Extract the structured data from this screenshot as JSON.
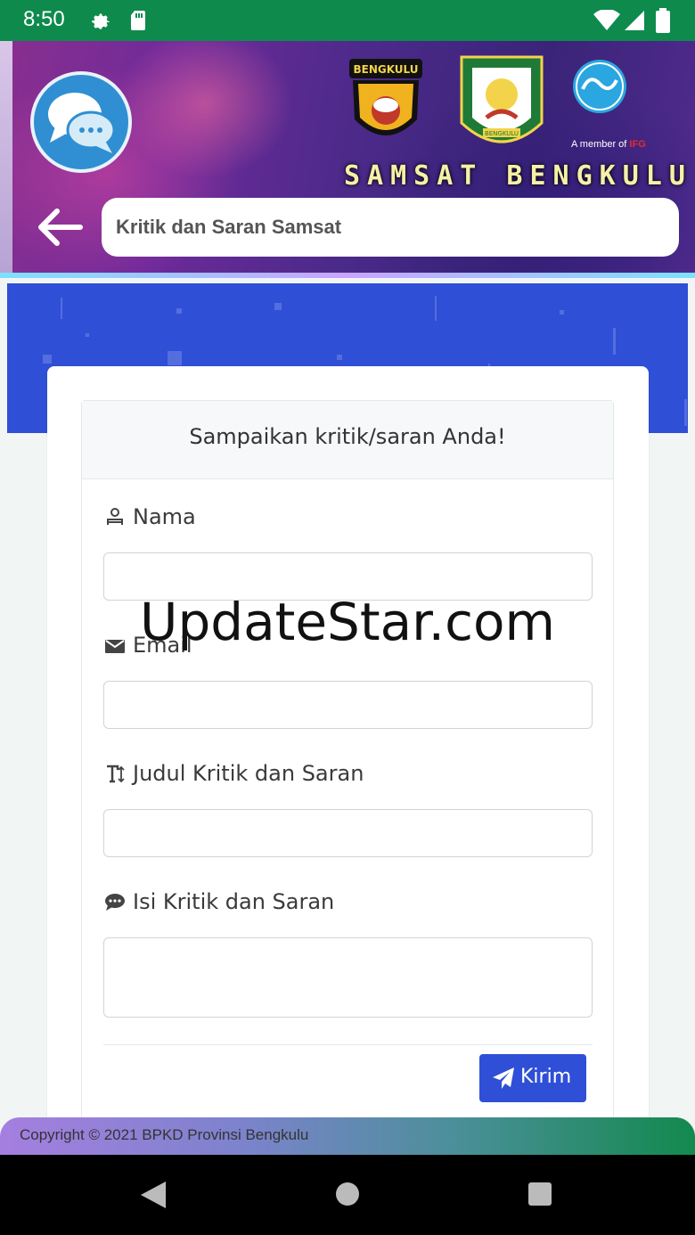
{
  "status_bar": {
    "time": "8:50",
    "icons": [
      "settings-icon",
      "sd-card-icon",
      "wifi-icon",
      "signal-icon",
      "battery-icon"
    ]
  },
  "header": {
    "police_badge_text": "BENGKULU",
    "crest_text": "BENGKULU",
    "partner_caption_prefix": "A member of",
    "partner_caption_brand": "IFG",
    "brand_title": "SAMSAT BENGKULU",
    "page_title": "Kritik dan Saran Samsat"
  },
  "form": {
    "heading": "Sampaikan kritik/saran Anda!",
    "fields": [
      {
        "label": "Nama",
        "icon": "person-icon",
        "value": "",
        "type": "input"
      },
      {
        "label": "Email",
        "icon": "envelope-icon",
        "value": "",
        "type": "input"
      },
      {
        "label": "Judul Kritik dan Saran",
        "icon": "text-height-icon",
        "value": "",
        "type": "input"
      },
      {
        "label": "Isi Kritik dan Saran",
        "icon": "comment-dots-icon",
        "value": "",
        "type": "textarea"
      }
    ],
    "submit_label": "Kirim"
  },
  "watermark": "UpdateStar.com",
  "footer": {
    "copyright": "Copyright © 2021 BPKD Provinsi Bengkulu"
  },
  "colors": {
    "status_bar": "#0e8a4d",
    "primary_blue": "#2f4fd7",
    "chat_bubble": "#2f8fd2",
    "brand_title": "#f6f0a8"
  }
}
